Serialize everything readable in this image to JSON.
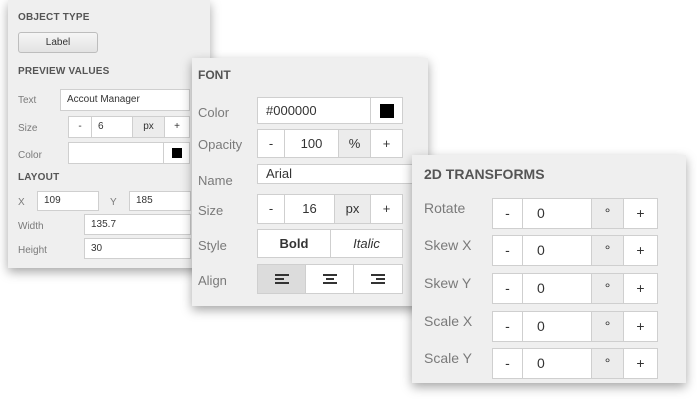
{
  "object_type": {
    "title": "OBJECT TYPE",
    "button_label": "Label"
  },
  "preview": {
    "title": "PREVIEW VALUES",
    "text_label": "Text",
    "text_value": "Accout Manager",
    "size_label": "Size",
    "size_minus": "-",
    "size_value": "6",
    "size_unit": "px",
    "size_plus": "+",
    "color_label": "Color",
    "color_value": "",
    "color_swatch": "#000000"
  },
  "layout": {
    "title": "LAYOUT",
    "x_label": "X",
    "x_value": "109",
    "y_label": "Y",
    "y_value": "185",
    "width_label": "Width",
    "width_value": "135.7",
    "height_label": "Height",
    "height_value": "30"
  },
  "font": {
    "title": "FONT",
    "color_label": "Color",
    "color_value": "#000000",
    "color_swatch": "#000000",
    "opacity_label": "Opacity",
    "opacity_minus": "-",
    "opacity_value": "100",
    "opacity_unit": "%",
    "opacity_plus": "+",
    "name_label": "Name",
    "name_value": "Arial",
    "size_label": "Size",
    "size_minus": "-",
    "size_value": "16",
    "size_unit": "px",
    "size_plus": "+",
    "style_label": "Style",
    "bold_label": "Bold",
    "italic_label": "Italic",
    "align_label": "Align",
    "align_selected": "left"
  },
  "transforms": {
    "title": "2D TRANSFORMS",
    "rows": [
      {
        "label": "Rotate",
        "minus": "-",
        "value": "0",
        "unit": "°",
        "plus": "+"
      },
      {
        "label": "Skew X",
        "minus": "-",
        "value": "0",
        "unit": "°",
        "plus": "+"
      },
      {
        "label": "Skew Y",
        "minus": "-",
        "value": "0",
        "unit": "°",
        "plus": "+"
      },
      {
        "label": "Scale X",
        "minus": "-",
        "value": "0",
        "unit": "°",
        "plus": "+"
      },
      {
        "label": "Scale Y",
        "minus": "-",
        "value": "0",
        "unit": "°",
        "plus": "+"
      }
    ]
  }
}
